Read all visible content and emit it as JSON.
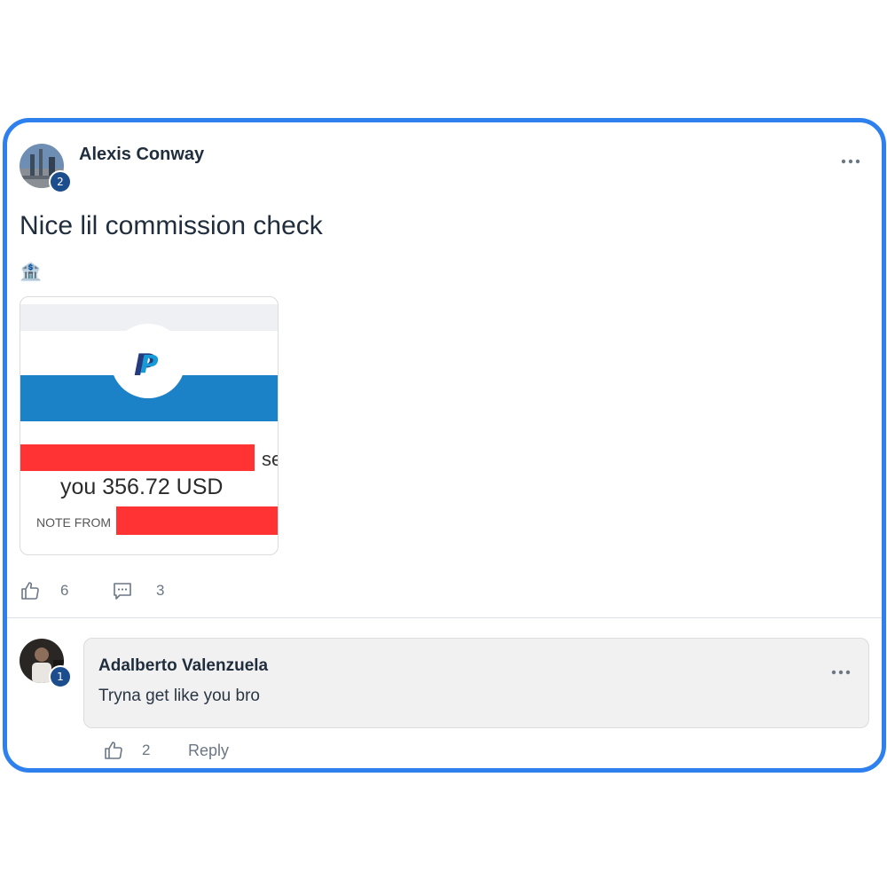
{
  "post": {
    "author": "Alexis Conway",
    "author_badge": "2",
    "title": "Nice lil commission check",
    "emoji": "🏦",
    "menu_icon": "more-horizontal-icon",
    "like_count": "6",
    "comment_count": "3",
    "image": {
      "brand": "PayPal",
      "line1_tail": "se",
      "amount_text": "you 356.72 USD",
      "note_label": "NOTE FROM",
      "colors": {
        "header_blue": "#1c82c7",
        "redaction": "#ff3333"
      }
    }
  },
  "comment": {
    "author": "Adalberto Valenzuela",
    "author_badge": "1",
    "text": "Tryna get like you bro",
    "like_count": "2",
    "reply_label": "Reply"
  },
  "colors": {
    "frame_border": "#2e80ef",
    "badge": "#1c4d8c"
  }
}
